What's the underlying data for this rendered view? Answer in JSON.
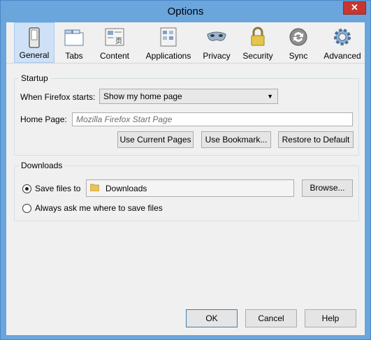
{
  "window": {
    "title": "Options",
    "close_glyph": "✕"
  },
  "toolbar": {
    "items": [
      {
        "label": "General",
        "icon": "switch-icon",
        "active": true
      },
      {
        "label": "Tabs",
        "icon": "tabs-icon",
        "active": false
      },
      {
        "label": "Content",
        "icon": "content-icon",
        "active": false
      },
      {
        "label": "Applications",
        "icon": "applications-icon",
        "active": false
      },
      {
        "label": "Privacy",
        "icon": "mask-icon",
        "active": false
      },
      {
        "label": "Security",
        "icon": "lock-icon",
        "active": false
      },
      {
        "label": "Sync",
        "icon": "sync-icon",
        "active": false
      },
      {
        "label": "Advanced",
        "icon": "gear-icon",
        "active": false
      }
    ]
  },
  "startup": {
    "title": "Startup",
    "when_starts_label": "When Firefox starts:",
    "when_starts_value": "Show my home page",
    "home_page_label": "Home Page:",
    "home_page_placeholder": "Mozilla Firefox Start Page",
    "use_current_label": "Use Current Pages",
    "use_bookmark_label": "Use Bookmark...",
    "restore_default_label": "Restore to Default"
  },
  "downloads": {
    "title": "Downloads",
    "save_files_label": "Save files to",
    "save_files_checked": true,
    "folder_name": "Downloads",
    "browse_label": "Browse...",
    "always_ask_label": "Always ask me where to save files",
    "always_ask_checked": false
  },
  "footer": {
    "ok_label": "OK",
    "cancel_label": "Cancel",
    "help_label": "Help"
  }
}
